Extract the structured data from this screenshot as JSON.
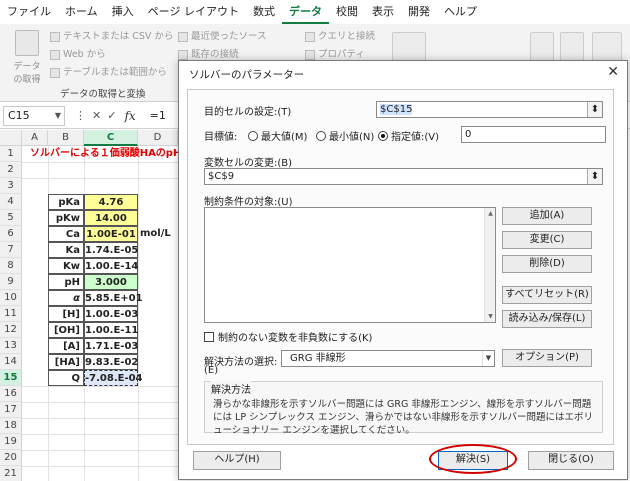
{
  "ribbon": {
    "tabs": [
      "ファイル",
      "ホーム",
      "挿入",
      "ページ レイアウト",
      "数式",
      "データ",
      "校閲",
      "表示",
      "開発",
      "ヘルプ"
    ],
    "active_tab": "データ",
    "get_data_label": "データの取得",
    "items_col1": [
      "テキストまたは CSV から",
      "Web から",
      "テーブルまたは範囲から"
    ],
    "items_col2": [
      "最近使ったソース",
      "既存の接続"
    ],
    "items_col3": [
      "クエリと接続",
      "プロパティ"
    ],
    "group_label": "データの取得と変換"
  },
  "formula_bar": {
    "name_box": "C15",
    "formula_prefix": "=1"
  },
  "sheet": {
    "columns": [
      "A",
      "B",
      "C",
      "D"
    ],
    "rows": [
      "1",
      "2",
      "3",
      "4",
      "5",
      "6",
      "7",
      "8",
      "9",
      "10",
      "11",
      "12",
      "13",
      "14",
      "15",
      "16",
      "17",
      "18",
      "19",
      "20",
      "21",
      "22",
      "23"
    ],
    "title": "ソルバーによる１価弱酸HAのpHの",
    "labels": [
      "pKa",
      "pKw",
      "Ca",
      "Ka",
      "Kw",
      "pH",
      "α",
      "[H]",
      "[OH]",
      "[A]",
      "[HA]",
      "Q"
    ],
    "values": [
      "4.76",
      "14.00",
      "1.00E-01",
      "1.74.E-05",
      "1.00.E-14",
      "3.000",
      "5.85.E+01",
      "1.00.E-03",
      "1.00.E-11",
      "1.71.E-03",
      "9.83.E-02",
      "-7.08.E-04"
    ],
    "unit": "mol/L",
    "colors": {
      "input": "#ffff99",
      "result": "#ccffcc",
      "target": "#dde7f7",
      "title": "#e00000",
      "accent": "#107c41"
    }
  },
  "dialog": {
    "title": "ソルバーのパラメーター",
    "objective_label": "目的セルの設定:(T)",
    "objective_value": "$C$15",
    "to_label": "目標値:",
    "radio_max": "最大値(M)",
    "radio_min": "最小値(N)",
    "radio_value": "指定値:(V)",
    "value_of": "0",
    "changing_label": "変数セルの変更:(B)",
    "changing_value": "$C$9",
    "constraints_label": "制約条件の対象:(U)",
    "btn_add": "追加(A)",
    "btn_change": "変更(C)",
    "btn_delete": "削除(D)",
    "btn_reset": "すべてリセット(R)",
    "btn_load": "読み込み/保存(L)",
    "nonneg_label": "制約のない変数を非負数にする(K)",
    "method_label": "解決方法の選択:",
    "method_label2": "(E)",
    "method_value": "GRG 非線形",
    "btn_options": "オプション(P)",
    "method_section_title": "解決方法",
    "method_desc": "滑らかな非線形を示すソルバー問題には GRG 非線形エンジン、線形を示すソルバー問題には LP シンプレックス エンジン、滑らかではない非線形を示すソルバー問題にはエボリューショナリー エンジンを選択してください。",
    "btn_help": "ヘルプ(H)",
    "btn_solve": "解決(S)",
    "btn_close": "閉じる(O)"
  }
}
